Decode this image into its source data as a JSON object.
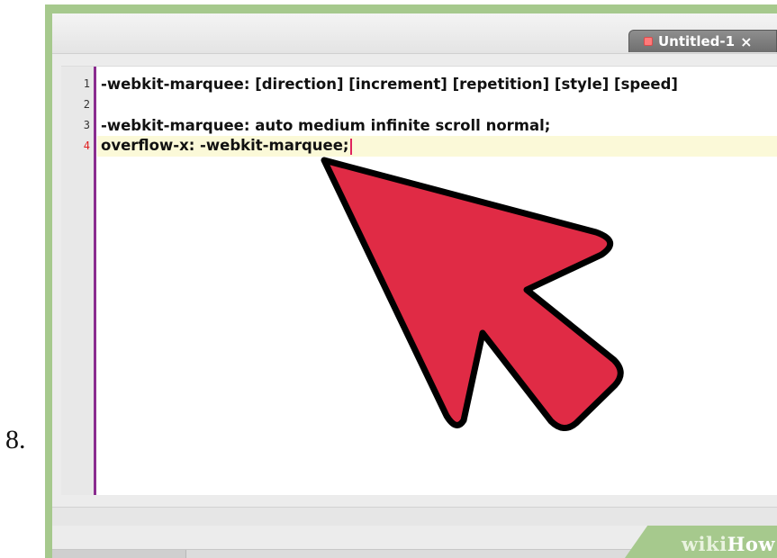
{
  "step": {
    "number": "8."
  },
  "tab": {
    "title": "Untitled-1",
    "close_glyph": "×"
  },
  "editor": {
    "lines": [
      {
        "number": "1",
        "text": "-webkit-marquee: [direction] [increment] [repetition] [style] [speed]"
      },
      {
        "number": "2",
        "text": ""
      },
      {
        "number": "3",
        "text": "-webkit-marquee: auto medium infinite scroll normal;"
      },
      {
        "number": "4",
        "text": "overflow-x: -webkit-marquee;"
      }
    ],
    "active_line": "4"
  },
  "watermark": {
    "prefix": "wiki",
    "suffix": "How"
  },
  "icons": {
    "pointer": "red-arrow-pointer-icon"
  },
  "colors": {
    "frame": "#a6c98d",
    "arrow_fill": "#e02b45",
    "gutter_rule": "#8a2c8f",
    "current_line": "#fbf9d8"
  }
}
